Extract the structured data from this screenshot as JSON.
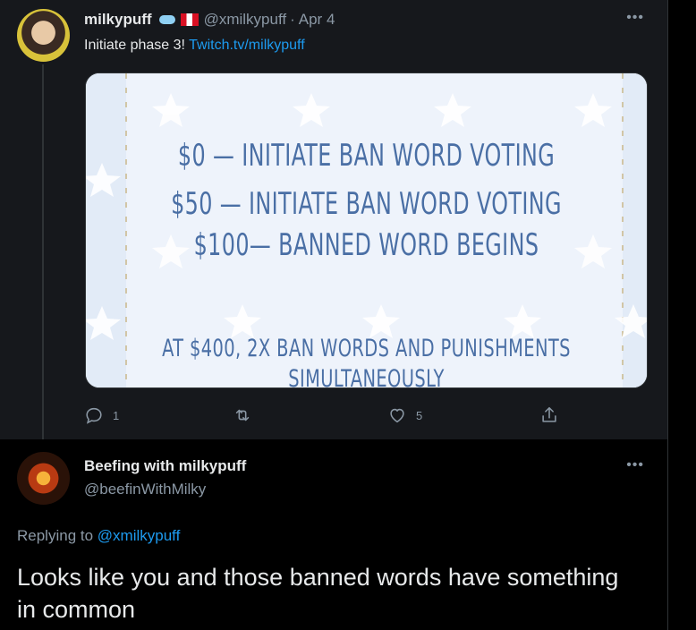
{
  "tweet1": {
    "display_name": "milkypuff",
    "emojis": [
      "cloud-emoji",
      "peru-flag-emoji"
    ],
    "handle": "@xmilkypuff",
    "time_separator": "·",
    "date": "Apr 4",
    "more_icon": "more-dots-icon",
    "text": "Initiate phase 3! ",
    "link_text": "Twitch.tv/milkypuff",
    "media_lines": [
      "$0 — INITIATE BAN WORD VOTING",
      "$50 — INITIATE BAN WORD VOTING",
      "$100— BANNED WORD BEGINS",
      "AT $400, 2X BAN WORDS AND PUNISHMENTS",
      "SIMULTANEOUSLY"
    ],
    "actions": {
      "reply_count": "1",
      "retweet_count": "",
      "like_count": "5"
    }
  },
  "tweet2": {
    "display_name": "Beefing with milkypuff",
    "handle": "@beefinWithMilky",
    "replying_to_prefix": "Replying to ",
    "replying_to_handle": "@xmilkypuff",
    "text": "Looks like you and those banned words have something in common"
  },
  "colors": {
    "background": "#000000",
    "tweet1_bg": "#16181c",
    "text_primary": "#e7e9ea",
    "text_secondary": "#8b98a5",
    "link": "#1d9bf0",
    "media_bg": "#eef3fb",
    "media_text": "#4a6fa5"
  }
}
